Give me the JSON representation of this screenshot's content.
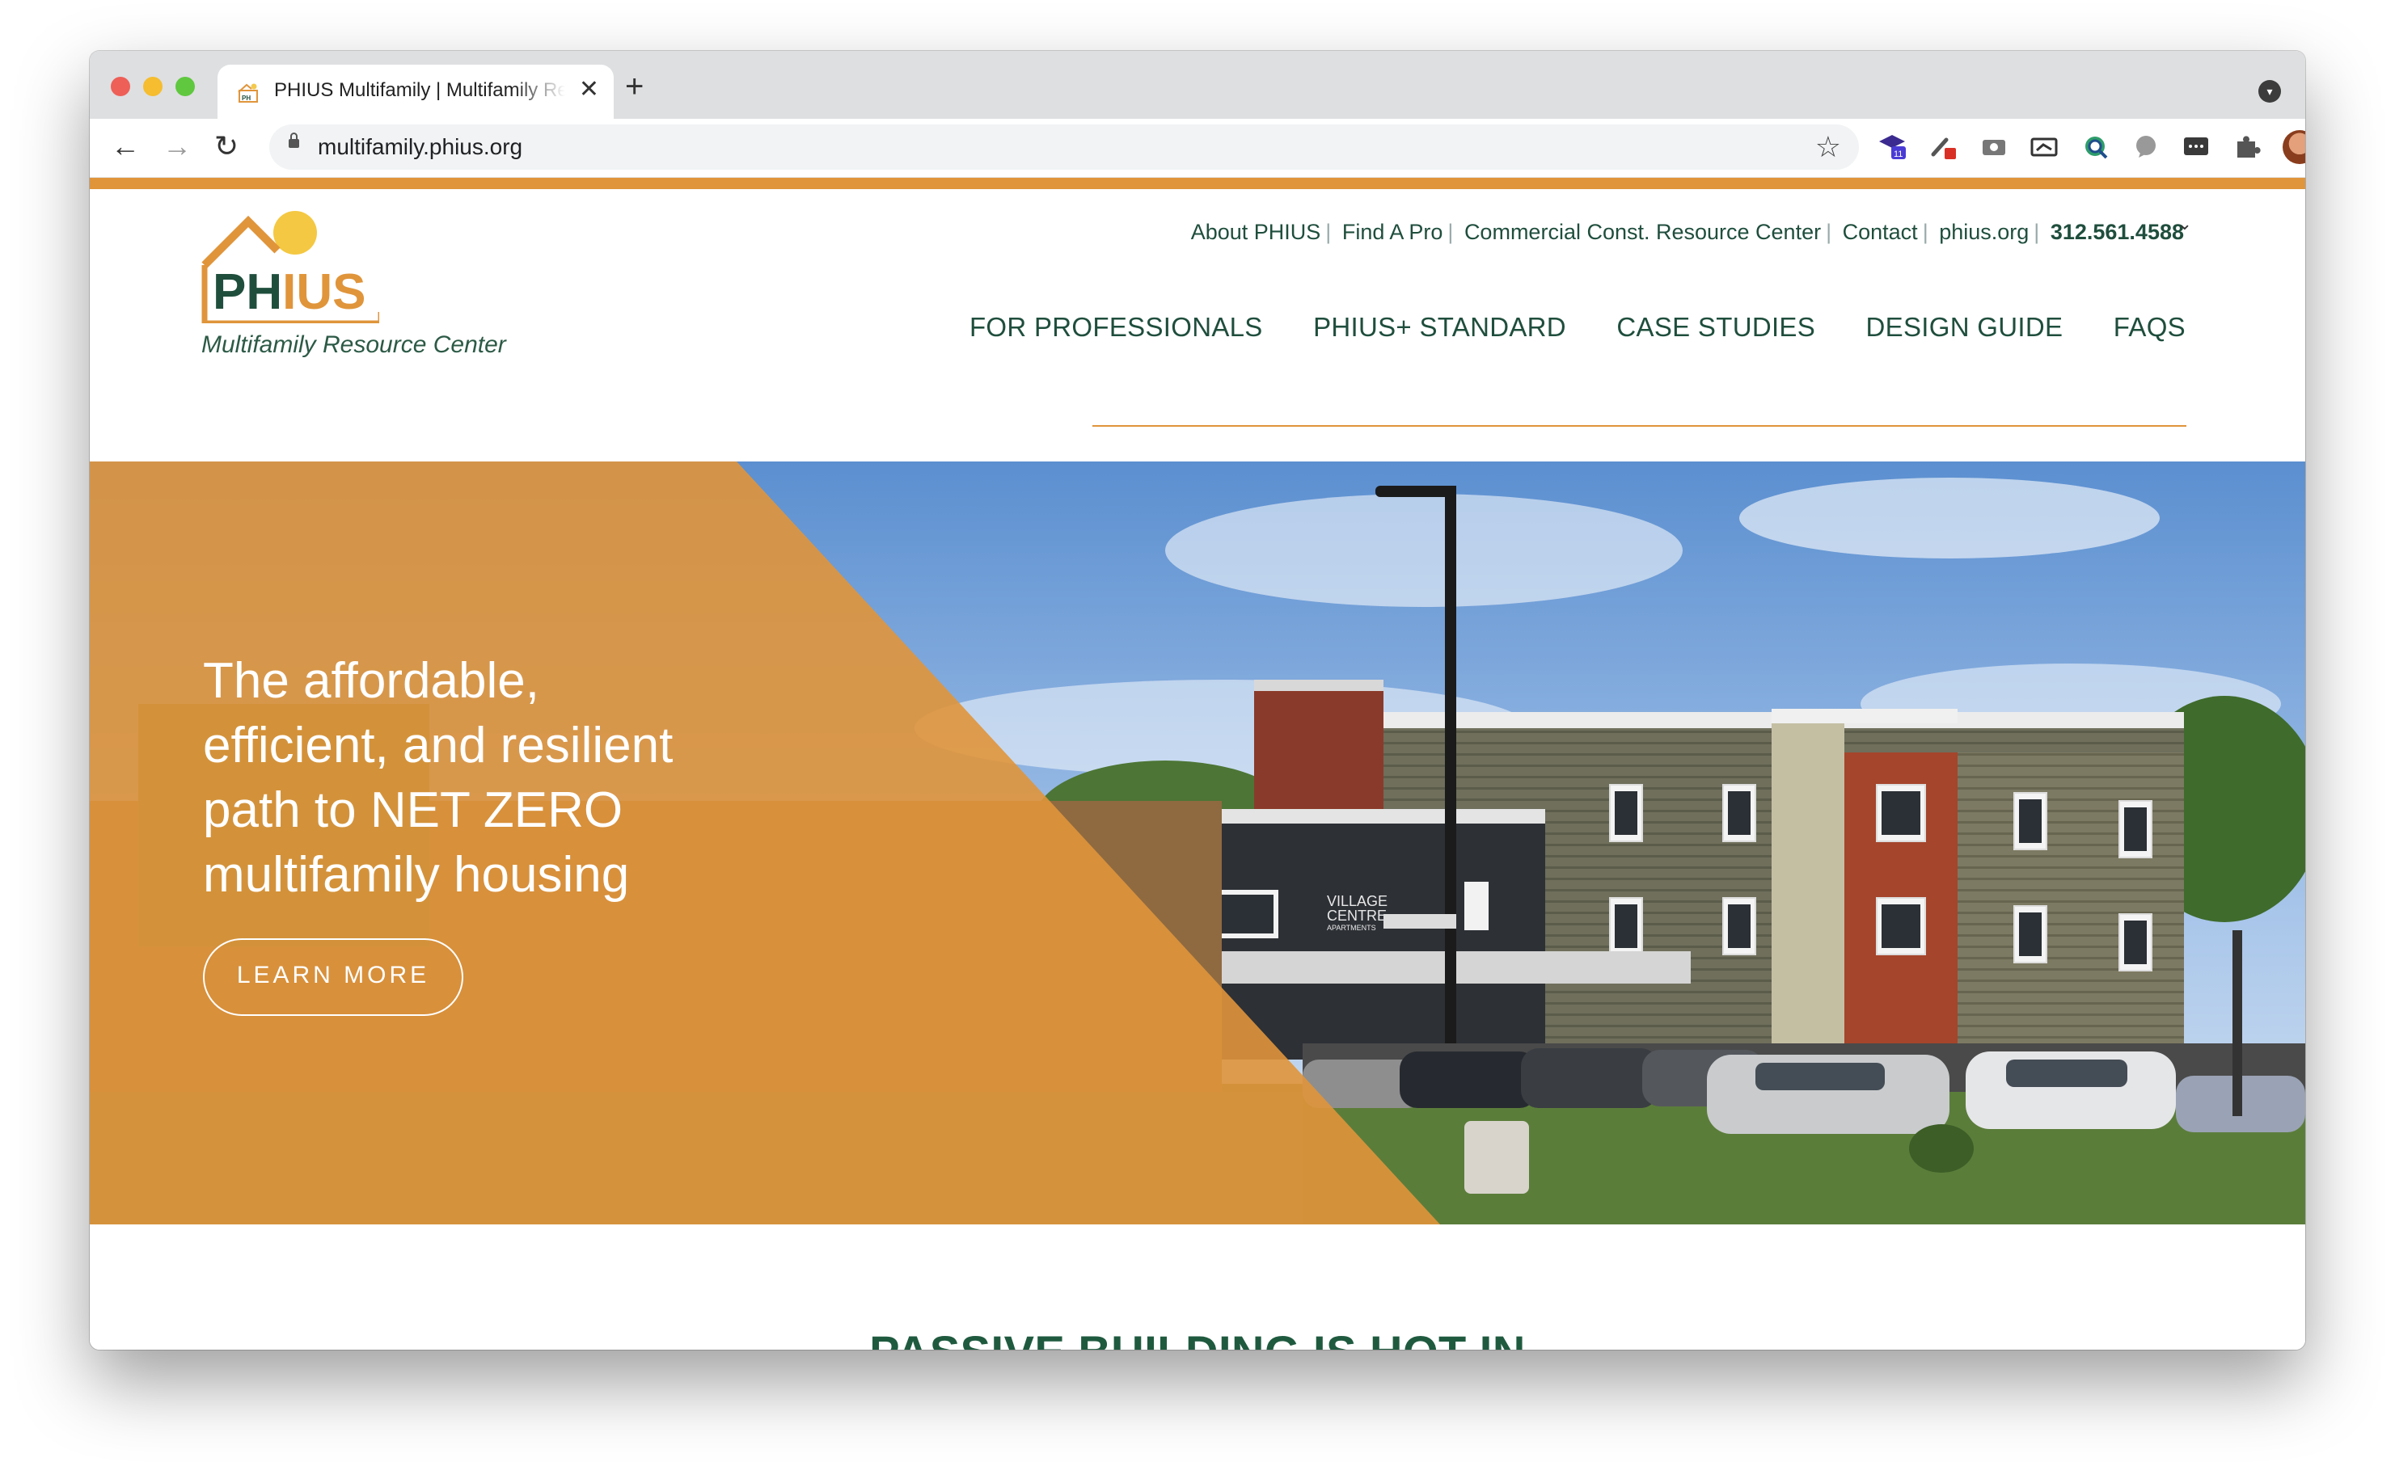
{
  "browser": {
    "tab_title": "PHIUS Multifamily | Multifamily Resource Center",
    "tab_close": "✕",
    "new_tab": "+",
    "url": "multifamily.phius.org",
    "back": "←",
    "forward": "→",
    "reload": "↻",
    "bookmark": "☆",
    "menu": "⋮",
    "tab_menu": "▾",
    "extension_badge": "11"
  },
  "site": {
    "logo_text_ph": "PH",
    "logo_text_ius": "IUS",
    "logo_subtitle": "Multifamily Resource Center",
    "colors": {
      "orange": "#e0953b",
      "green": "#1f4e3d",
      "hero_overlay": "#e0953b"
    },
    "utility_nav": [
      "About PHIUS",
      "Find A Pro",
      "Commercial Const. Resource Center",
      "Contact",
      "phius.org"
    ],
    "phone": "312.561.4588",
    "utility_chevron": "⌄",
    "main_nav": [
      "FOR PROFESSIONALS",
      "PHIUS+ STANDARD",
      "CASE STUDIES",
      "DESIGN GUIDE",
      "FAQS"
    ]
  },
  "hero": {
    "heading_lines": [
      "The affordable,",
      "efficient, and resilient",
      "path to NET ZERO",
      "multifamily housing"
    ],
    "button_label": "LEARN MORE",
    "sign_text_1": "VILLAGE",
    "sign_text_2": "CENTRE",
    "sign_text_3": "APARTMENTS"
  },
  "section": {
    "title": "PASSIVE BUILDING IS HOT IN"
  }
}
